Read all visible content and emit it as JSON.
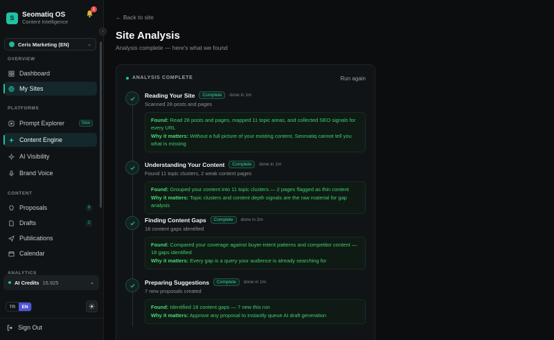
{
  "brand": {
    "logo": "S",
    "name": "Seomatiq OS",
    "subtitle": "Content Intelligence",
    "notifications": "1"
  },
  "site_select": {
    "value": "Ceris Marketing (EN)"
  },
  "sidebar": {
    "overview_label": "OVERVIEW",
    "overview": [
      {
        "label": "Dashboard",
        "icon": "grid-icon"
      },
      {
        "label": "My Sites",
        "icon": "globe-icon",
        "active": true
      }
    ],
    "platforms_label": "PLATFORMS",
    "platforms": [
      {
        "label": "Prompt Explorer",
        "icon": "explore-icon",
        "badge": "New"
      },
      {
        "label": "Content Engine",
        "icon": "sparkle-icon",
        "active": true
      },
      {
        "label": "AI Visibility",
        "icon": "eye-icon"
      },
      {
        "label": "Brand Voice",
        "icon": "mic-icon"
      }
    ],
    "content_label": "CONTENT",
    "content": [
      {
        "label": "Proposals",
        "icon": "bulb-icon",
        "count": "9"
      },
      {
        "label": "Drafts",
        "icon": "document-icon",
        "count": "2"
      },
      {
        "label": "Publications",
        "icon": "send-icon"
      },
      {
        "label": "Calendar",
        "icon": "calendar-icon"
      }
    ],
    "analytics_label": "ANALYTICS",
    "credits": {
      "label": "AI Credits",
      "value": "15.925"
    },
    "lang": {
      "tr": "TR",
      "en": "EN"
    },
    "signout": "Sign Out"
  },
  "main": {
    "back": "← Back to site",
    "title": "Site Analysis",
    "subtitle": "Analysis complete — here's what we found",
    "status": "ANALYSIS COMPLETE",
    "run_again": "Run again",
    "steps": [
      {
        "title": "Reading Your Site",
        "status": "Complete",
        "time": "done in 1m",
        "sub": "Scanned 28 posts and pages",
        "found_label": "Found:",
        "found": "Read 28 posts and pages, mapped 11 topic areas, and collected SEO signals for every URL",
        "why_label": "Why it matters:",
        "why": "Without a full picture of your existing content, Seomatiq cannot tell you what is missing"
      },
      {
        "title": "Understanding Your Content",
        "status": "Complete",
        "time": "done in 1m",
        "sub": "Found 11 topic clusters, 2 weak content pages",
        "found_label": "Found:",
        "found": "Grouped your content into 11 topic clusters — 2 pages flagged as thin content",
        "why_label": "Why it matters:",
        "why": "Topic clusters and content depth signals are the raw material for gap analysis"
      },
      {
        "title": "Finding Content Gaps",
        "status": "Complete",
        "time": "done in 2m",
        "sub": "18 content gaps identified",
        "found_label": "Found:",
        "found": "Compared your coverage against buyer-intent patterns and competitor content — 18 gaps identified",
        "why_label": "Why it matters:",
        "why": "Every gap is a query your audience is already searching for"
      },
      {
        "title": "Preparing Suggestions",
        "status": "Complete",
        "time": "done in 1m",
        "sub": "7 new proposals created",
        "found_label": "Found:",
        "found": "Identified 18 content gaps — 7 new this run",
        "why_label": "Why it matters:",
        "why": "Approve any proposal to instantly queue AI draft generation"
      }
    ]
  }
}
